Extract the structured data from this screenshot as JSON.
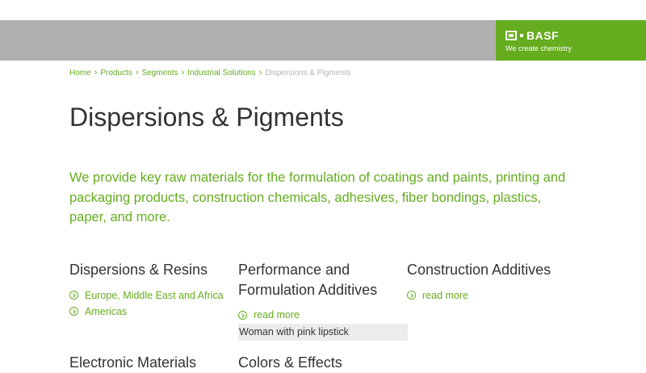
{
  "brand": {
    "name": "BASF",
    "tagline": "We create chemistry",
    "color": "#65ac1e"
  },
  "breadcrumb": {
    "items": [
      "Home",
      "Products",
      "Segments",
      "Industrial Solutions"
    ],
    "current": "Dispersions & Pigments",
    "separator_icon": "chevron-right-icon"
  },
  "page": {
    "title": "Dispersions & Pigments",
    "intro": "We provide key raw materials for the formulation of coatings and paints, printing and packaging products, construction chemicals, adhesives, fiber bondings, plastics, paper, and more."
  },
  "segments": [
    {
      "title": "Dispersions & Resins",
      "links": [
        "Europe, Middle East and Africa",
        "Americas"
      ]
    },
    {
      "title": "Performance and Formulation Additives",
      "links": [
        "read more"
      ],
      "image_alt": "Woman with pink lipstick"
    },
    {
      "title": "Construction Additives",
      "links": [
        "read more"
      ]
    },
    {
      "title": "Electronic Materials"
    },
    {
      "title": "Colors & Effects"
    }
  ],
  "link_icon": "arrow-circle-icon"
}
